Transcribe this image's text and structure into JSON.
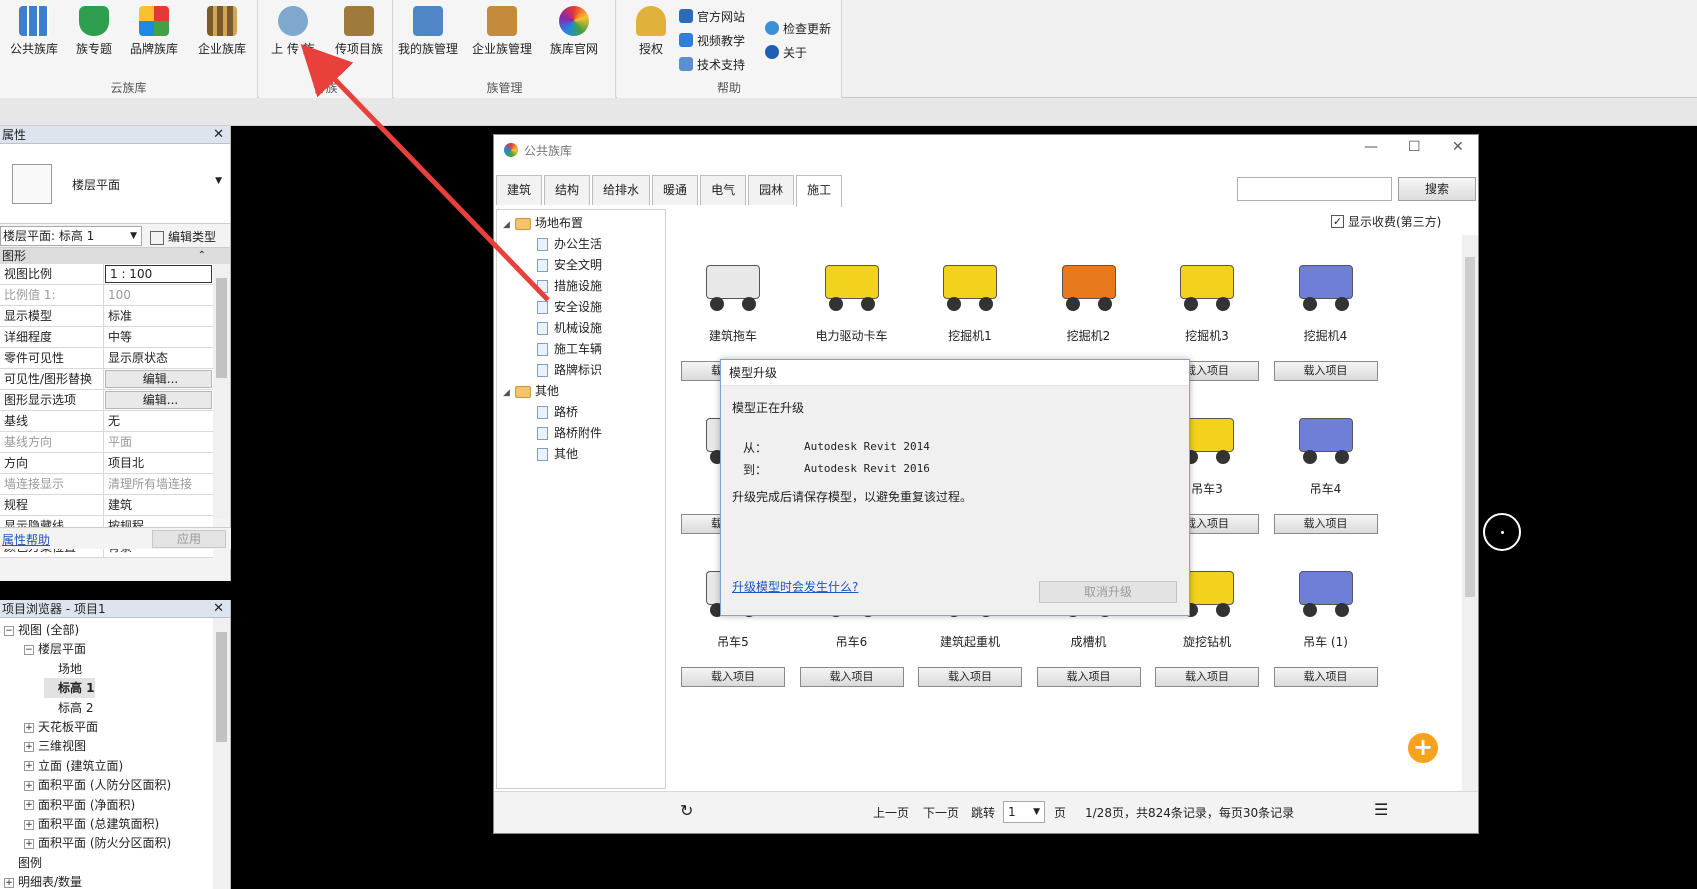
{
  "ribbon": {
    "groups": [
      {
        "label": "云族库",
        "buttons": [
          "公共族库",
          "族专题",
          "品牌族库",
          "企业族库"
        ]
      },
      {
        "label": "传族",
        "buttons": [
          "上 传 族",
          "传项目族"
        ]
      },
      {
        "label": "族管理",
        "buttons": [
          "我的族管理",
          "企业族管理",
          "族库官网"
        ]
      },
      {
        "label": "帮助",
        "buttons": [
          "授权"
        ]
      }
    ],
    "help_links": [
      "官方网站",
      "视频教学",
      "技术支持",
      "检查更新",
      "关于"
    ]
  },
  "properties": {
    "title": "属性",
    "type_name": "楼层平面",
    "selector": "楼层平面: 标高 1",
    "edit_type": "编辑类型",
    "section": "图形",
    "rows": [
      {
        "k": "视图比例",
        "v": "1 : 100"
      },
      {
        "k": "比例值 1:",
        "v": "100"
      },
      {
        "k": "显示模型",
        "v": "标准"
      },
      {
        "k": "详细程度",
        "v": "中等"
      },
      {
        "k": "零件可见性",
        "v": "显示原状态"
      },
      {
        "k": "可见性/图形替换",
        "v": "编辑..."
      },
      {
        "k": "图形显示选项",
        "v": "编辑..."
      },
      {
        "k": "基线",
        "v": "无"
      },
      {
        "k": "基线方向",
        "v": "平面"
      },
      {
        "k": "方向",
        "v": "项目北"
      },
      {
        "k": "墙连接显示",
        "v": "清理所有墙连接"
      },
      {
        "k": "规程",
        "v": "建筑"
      },
      {
        "k": "显示隐藏线",
        "v": "按规程"
      },
      {
        "k": "颜色方案位置",
        "v": "背景"
      }
    ],
    "help_link": "属性帮助",
    "apply": "应用"
  },
  "browser": {
    "title": "项目浏览器 - 项目1",
    "items": [
      {
        "label": "视图 (全部)",
        "level": 0,
        "tog": "−"
      },
      {
        "label": "楼层平面",
        "level": 1,
        "tog": "−"
      },
      {
        "label": "场地",
        "level": 2,
        "tog": ""
      },
      {
        "label": "标高 1",
        "level": 2,
        "tog": ""
      },
      {
        "label": "标高 2",
        "level": 2,
        "tog": ""
      },
      {
        "label": "天花板平面",
        "level": 1,
        "tog": "+"
      },
      {
        "label": "三维视图",
        "level": 1,
        "tog": "+"
      },
      {
        "label": "立面 (建筑立面)",
        "level": 1,
        "tog": "+"
      },
      {
        "label": "面积平面 (人防分区面积)",
        "level": 1,
        "tog": "+"
      },
      {
        "label": "面积平面 (净面积)",
        "level": 1,
        "tog": "+"
      },
      {
        "label": "面积平面 (总建筑面积)",
        "level": 1,
        "tog": "+"
      },
      {
        "label": "面积平面 (防火分区面积)",
        "level": 1,
        "tog": "+"
      },
      {
        "label": "图例",
        "level": 0,
        "tog": ""
      },
      {
        "label": "明细表/数量",
        "level": 0,
        "tog": "+"
      }
    ]
  },
  "library": {
    "title": "公共族库",
    "tabs": [
      "建筑",
      "结构",
      "给排水",
      "暖通",
      "电气",
      "园林",
      "施工"
    ],
    "search_label": "搜索",
    "fee_checkbox": "显示收费(第三方)",
    "tree": {
      "folder1": "场地布置",
      "children1": [
        "办公生活",
        "安全文明",
        "措施设施",
        "安全设施",
        "机械设施",
        "施工车辆",
        "路牌标识"
      ],
      "folder2": "其他",
      "children2": [
        "路桥",
        "路桥附件",
        "其他"
      ]
    },
    "cards": [
      {
        "name": "建筑拖车"
      },
      {
        "name": "电力驱动卡车"
      },
      {
        "name": "挖掘机1"
      },
      {
        "name": "挖掘机2"
      },
      {
        "name": "挖掘机3"
      },
      {
        "name": "挖掘机4"
      },
      {
        "name": ""
      },
      {
        "name": ""
      },
      {
        "name": ""
      },
      {
        "name": ""
      },
      {
        "name": "吊车3"
      },
      {
        "name": "吊车4"
      },
      {
        "name": "吊车5"
      },
      {
        "name": "吊车6"
      },
      {
        "name": "建筑起重机"
      },
      {
        "name": "成槽机"
      },
      {
        "name": "旋挖钻机"
      },
      {
        "name": "吊车 (1)"
      }
    ],
    "load_label": "载入项目",
    "footer": {
      "prev": "上一页",
      "next": "下一页",
      "jump": "跳转",
      "page_value": "1",
      "page_unit": "页",
      "summary": "1/28页，共824条记录，每页30条记录"
    }
  },
  "upgrade": {
    "title": "模型升级",
    "status": "模型正在升级",
    "from_label": "从：",
    "from_value": "Autodesk Revit 2014",
    "to_label": "到：",
    "to_value": "Autodesk Revit 2016",
    "note": "升级完成后请保存模型，以避免重复该过程。",
    "link": "升级模型时会发生什么?",
    "cancel": "取消升级"
  },
  "colors": {
    "accent_blue": "#1a56c4",
    "arrow_red": "#e8413b",
    "fab_orange": "#f7a21b",
    "machine_yellow": "#f2d21c"
  }
}
